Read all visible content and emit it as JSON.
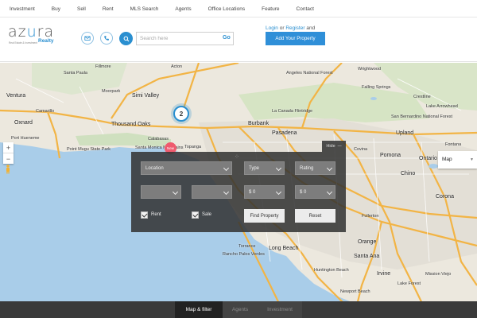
{
  "nav": {
    "items": [
      "Investment",
      "Buy",
      "Sell",
      "Rent",
      "MLS Search",
      "Agents",
      "Office Locations",
      "Feature",
      "Contact"
    ]
  },
  "logo": {
    "word_start": "az",
    "word_accent": "u",
    "word_end": "ra",
    "tagline": "Real Estate & Investment",
    "realty": "Realty"
  },
  "header": {
    "search_placeholder": "Search here",
    "go_label": "Go",
    "login_label": "Login",
    "or_label": "or",
    "register_label": "Register",
    "and_label": "and",
    "add_property_label": "Add Your Property",
    "accent_color": "#2a8fd0"
  },
  "map": {
    "cluster_count": "2",
    "pin_label": "New",
    "map_type": "Map",
    "places": {
      "acton": "Acton",
      "santa_paula": "Santa Paula",
      "fillmore": "Fillmore",
      "ventura": "Ventura",
      "moorpark": "Moorpark",
      "simi_valley": "Simi Valley",
      "camarillo": "Camarillo",
      "oxnard": "Oxnard",
      "thousand_oaks": "Thousand Oaks",
      "port_hueneme": "Port Hueneme",
      "calabasas": "Calabasas",
      "topanga": "Topanga",
      "santa_monica_mtns": "Santa Monica Mountains",
      "point_mugu": "Point Mugu State Park",
      "burbank": "Burbank",
      "la_canada": "La Canada Flintridge",
      "pasadena": "Pasadena",
      "upland": "Upland",
      "crestline": "Crestline",
      "lake_arrowhead": "Lake Arrowhead",
      "san_bernardino_nf": "San Bernardino National Forest",
      "angeles_nf": "Angeles National Forest",
      "wrightwood": "Wrightwood",
      "falling_springs": "Falling Springs",
      "covina": "Covina",
      "pomona": "Pomona",
      "ontario": "Ontario",
      "chino": "Chino",
      "fontana": "Fontana",
      "long_beach": "Long Beach",
      "torrance": "Torrance",
      "palos_verdes": "Rancho Palos Verdes",
      "orange": "Orange",
      "santa_ana": "Santa Ana",
      "irvine": "Irvine",
      "fullerton": "Fullerton",
      "corona": "Corona",
      "lake_forest": "Lake Forest",
      "newport_beach": "Newport Beach",
      "huntington_beach": "Huntington Beach",
      "mission_viejo": "Mission Viejo"
    }
  },
  "filter": {
    "hide_label": "Hide",
    "location_label": "Location",
    "type_label": "Type",
    "rating_label": "Rating",
    "price_min": "$ 0",
    "price_max": "$ 0",
    "rent_label": "Rent",
    "sale_label": "Sale",
    "rent_checked": true,
    "sale_checked": true,
    "find_label": "Find Property",
    "reset_label": "Reset"
  },
  "tabs": {
    "items": [
      "Map & filter",
      "Agents",
      "Investment"
    ],
    "active": "Map & filter"
  }
}
